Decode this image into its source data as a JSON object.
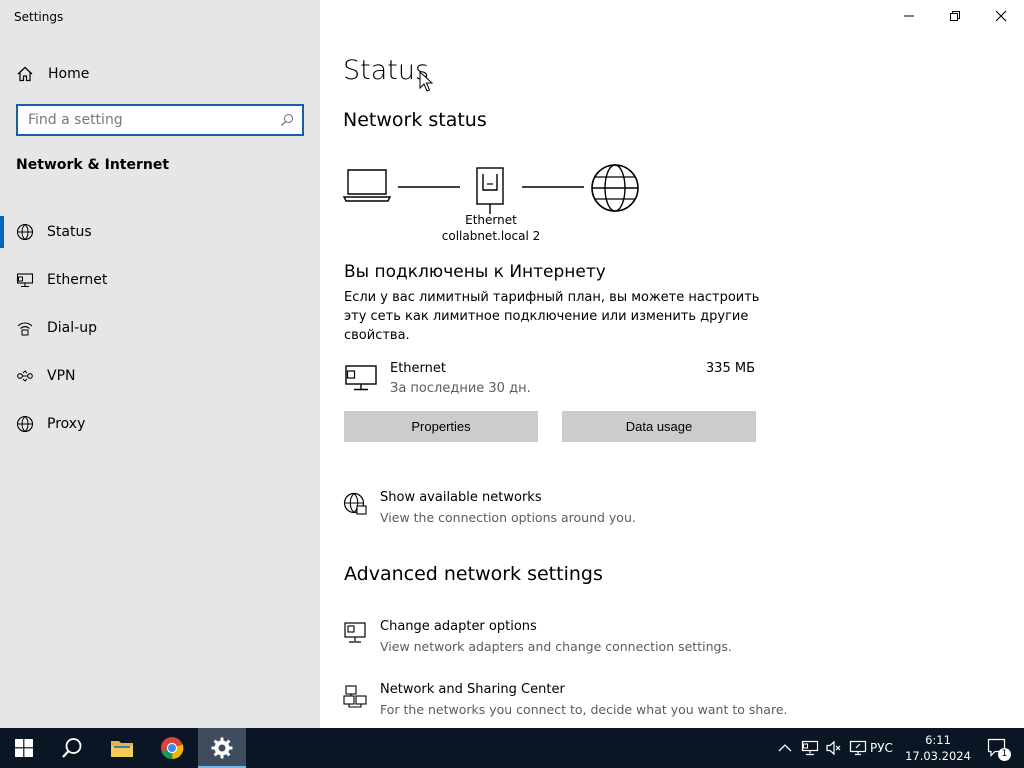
{
  "window": {
    "title": "Settings",
    "controls": {
      "minimize": "minimize-icon",
      "restore": "restore-icon",
      "close": "close-icon"
    }
  },
  "sidebar": {
    "home_label": "Home",
    "search": {
      "placeholder": "Find a setting",
      "value": ""
    },
    "section_title": "Network & Internet",
    "active_item": "Status",
    "items": [
      {
        "label": "Status",
        "icon": "status-icon"
      },
      {
        "label": "Ethernet",
        "icon": "ethernet-icon"
      },
      {
        "label": "Dial-up",
        "icon": "dial-up-icon"
      },
      {
        "label": "VPN",
        "icon": "vpn-icon"
      },
      {
        "label": "Proxy",
        "icon": "proxy-icon"
      }
    ]
  },
  "main": {
    "title": "Status",
    "network_status_heading": "Network status",
    "diagram": {
      "adapter_label": "Ethernet",
      "network_label": "collabnet.local 2",
      "icons": [
        "laptop-icon",
        "ethernet-port-icon",
        "globe-icon"
      ]
    },
    "connected_heading": "Вы подключены к Интернету",
    "connected_desc": "Если у вас лимитный тарифный план, вы можете настроить эту сеть как лимитное подключение или изменить другие свойства.",
    "adapter": {
      "name": "Ethernet",
      "period": "За последние 30 дн.",
      "usage": "335 МБ"
    },
    "buttons": {
      "properties": "Properties",
      "data_usage": "Data usage"
    },
    "show_networks": {
      "title": "Show available networks",
      "subtitle": "View the connection options around you."
    },
    "advanced_heading": "Advanced network settings",
    "change_adapter": {
      "title": "Change adapter options",
      "subtitle": "View network adapters and change connection settings."
    },
    "sharing_center": {
      "title": "Network and Sharing Center",
      "subtitle": "For the networks you connect to, decide what you want to share."
    }
  },
  "taskbar": {
    "pinned": [
      "windows-start-icon",
      "search-icon",
      "file-explorer-icon",
      "chrome-icon",
      "settings-gear-icon"
    ],
    "tray_icons": [
      "chevron-up-icon",
      "network-icon",
      "volume-icon",
      "display-icon"
    ],
    "language": "РУС",
    "time": "6:11",
    "date": "17.03.2024",
    "notification_count": "1"
  },
  "colors": {
    "accent": "#0067c0",
    "sidebar_bg": "#e6e6e6",
    "button_bg": "#cccccc",
    "taskbar_bg": "#0a1624"
  }
}
